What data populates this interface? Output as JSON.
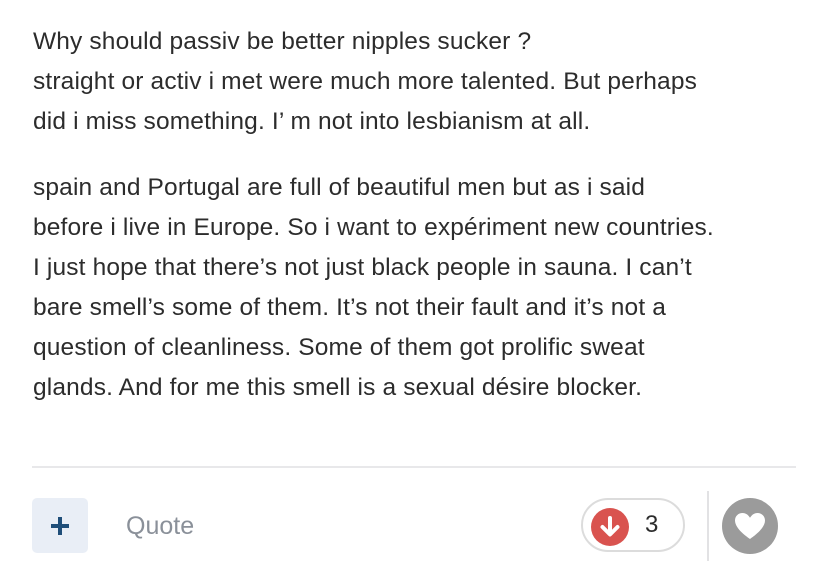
{
  "post": {
    "paragraph_1": [
      "Why should passiv be better nipples sucker ?",
      "straight or activ i met were much more talented. But perhaps",
      "did i miss something. I’ m not into lesbianism at all."
    ],
    "paragraph_2": [
      "spain and Portugal are full of beautiful men but as i said",
      "before i live in Europe. So i want to expériment new countries.",
      "I just hope that there’s not just black people in sauna. I can’t",
      "bare smell’s some of them. It’s not their fault and it’s not a",
      "question of cleanliness. Some of them got prolific sweat",
      "glands. And for me this smell is a sexual désire blocker."
    ]
  },
  "actions": {
    "plus_icon": "plus-icon",
    "quote_label": "Quote",
    "reaction": {
      "icon": "arrow-down-icon",
      "color": "#d9534f",
      "count": "3"
    },
    "like_icon": "heart-icon",
    "like_color": "#9b9b9b"
  }
}
